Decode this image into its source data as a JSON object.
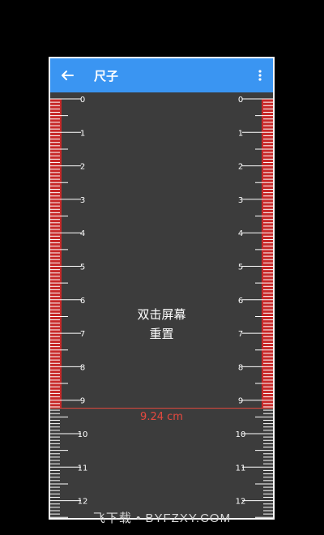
{
  "app": {
    "title": "尺子"
  },
  "icons": {
    "back": "arrow-left-icon",
    "menu": "more-vertical-icon"
  },
  "colors": {
    "appbar": "#3a95f2",
    "background": "#3c3c3c",
    "highlight": "#c62828",
    "measure_text": "#e5493f",
    "tick": "#ffffff"
  },
  "ruler": {
    "unit": "cm",
    "labels": [
      "0",
      "1",
      "2",
      "3",
      "4",
      "5",
      "6",
      "7",
      "8",
      "9",
      "10",
      "11",
      "12"
    ],
    "measured_value_cm": 9.24
  },
  "hint": {
    "line1": "双击屏幕",
    "line2": "重置"
  },
  "measurement": {
    "text": "9.24 cm"
  },
  "watermark": {
    "text": "飞下载 • BYFZXY.COM"
  }
}
